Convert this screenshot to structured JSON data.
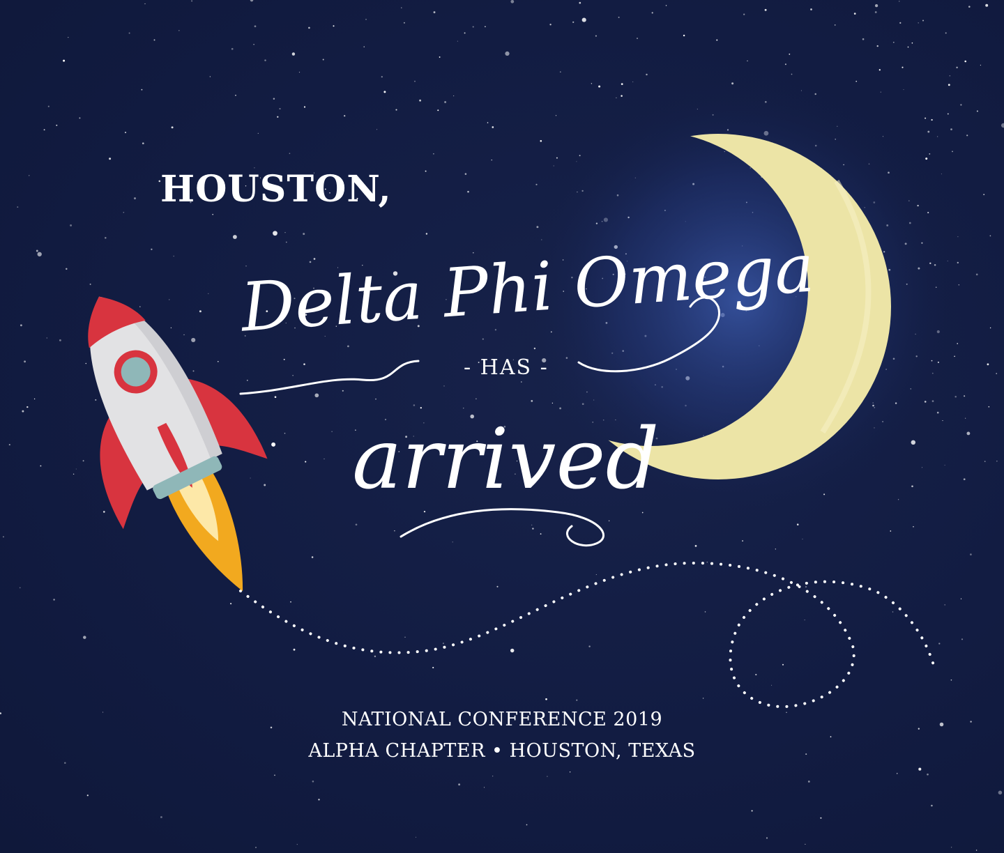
{
  "headline": {
    "houston": "HOUSTON,",
    "org_name": "Delta Phi Omega",
    "has": "- HAS -",
    "arrived": "arrived"
  },
  "footer": {
    "line1": "NATIONAL CONFERENCE 2019",
    "line2": "ALPHA CHAPTER • HOUSTON, TEXAS"
  },
  "colors": {
    "background": "#111b3e",
    "moon": "#ece4a6",
    "rocket_body": "#e2e2e4",
    "rocket_red": "#d8343f",
    "rocket_window": "#8fb7b8",
    "flame": "#f2a91f",
    "text": "#ffffff"
  }
}
